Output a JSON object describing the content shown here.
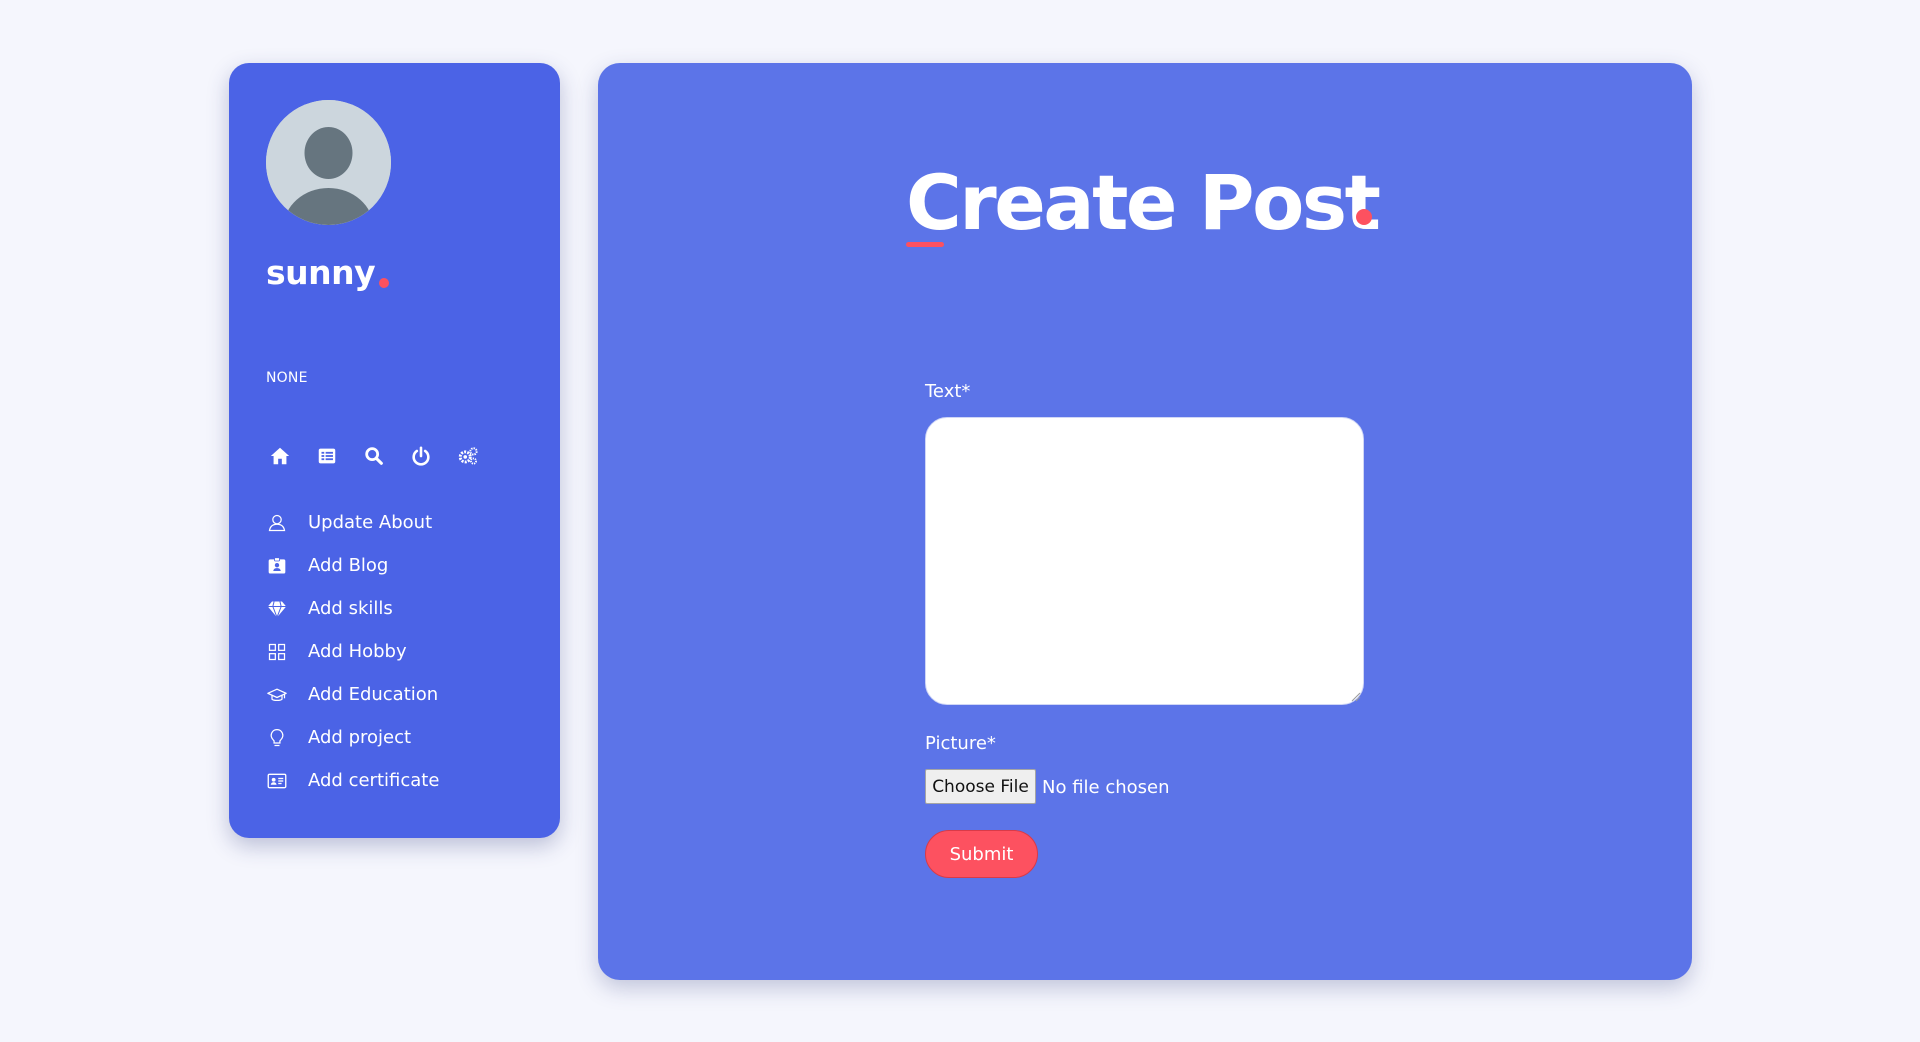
{
  "sidebar": {
    "user_name": "sunny",
    "user_role": "NONE",
    "quick_icons": [
      "home-icon",
      "list-icon",
      "search-icon",
      "power-icon",
      "cogs-icon"
    ],
    "menu": [
      {
        "label": "Update About",
        "icon": "user-icon"
      },
      {
        "label": "Add Blog",
        "icon": "id-badge-icon"
      },
      {
        "label": "Add skills",
        "icon": "diamond-icon"
      },
      {
        "label": "Add Hobby",
        "icon": "grid-icon"
      },
      {
        "label": "Add Education",
        "icon": "graduation-cap-icon"
      },
      {
        "label": "Add project",
        "icon": "lightbulb-icon"
      },
      {
        "label": "Add certificate",
        "icon": "id-card-icon"
      }
    ]
  },
  "main": {
    "title": "Create Post",
    "text_label": "Text*",
    "text_value": "",
    "picture_label": "Picture*",
    "choose_file_label": "Choose File",
    "no_file_text": "No file chosen",
    "submit_label": "Submit"
  },
  "colors": {
    "background": "#f5f6fd",
    "sidebar": "#4b63e6",
    "main_panel": "#5c74e8",
    "accent": "#fd5160",
    "text": "#ffffff"
  }
}
